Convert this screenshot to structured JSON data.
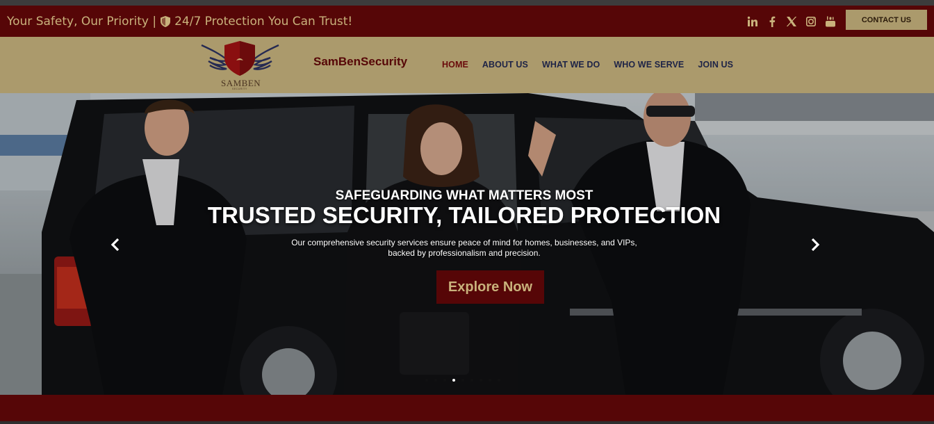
{
  "topbar": {
    "tagline_left": "Your Safety, Our Priority |",
    "tagline_right": "24/7 Protection You Can Trust!",
    "contact_label": "CONTACT US",
    "social_icons": [
      "linkedin-icon",
      "facebook-icon",
      "x-icon",
      "instagram-icon",
      "youtube-icon"
    ]
  },
  "header": {
    "brand": "SamBenSecurity",
    "logo_text": "SAMBEN",
    "logo_subtext": "SECURITY",
    "nav": [
      {
        "label": "HOME",
        "active": true
      },
      {
        "label": "ABOUT US",
        "active": false
      },
      {
        "label": "WHAT WE DO",
        "active": false
      },
      {
        "label": "WHO WE SERVE",
        "active": false
      },
      {
        "label": "JOIN US",
        "active": false
      }
    ]
  },
  "hero": {
    "subtitle": "SAFEGUARDING WHAT MATTERS MOST",
    "title": "TRUSTED SECURITY, TAILORED PROTECTION",
    "description": "Our comprehensive security services ensure peace of mind for homes, businesses, and VIPs, backed by professionalism and precision.",
    "button_label": "Explore Now",
    "slides_count": 9,
    "active_slide": 3
  },
  "colors": {
    "maroon": "#560607",
    "gold": "#ab9a6c",
    "gold_text": "#c9b27c",
    "nav_text": "#1d2346"
  }
}
